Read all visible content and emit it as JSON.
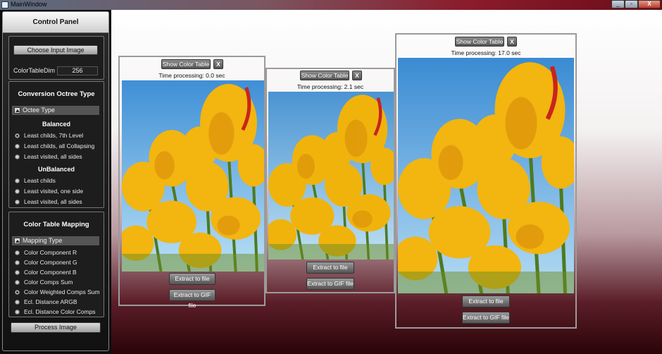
{
  "window": {
    "title": "MainWindow",
    "min": "_",
    "max": "▫",
    "close": "X"
  },
  "control_panel": {
    "title": "Control Panel",
    "choose_input_label": "Choose Input Image",
    "color_table_dim_label": "ColorTableDim",
    "color_table_dim_value": "256",
    "conversion": {
      "title": "Conversion Octree Type",
      "expander_label": "Octee Type",
      "balanced_title": "Balanced",
      "balanced_options": [
        "Least childs, 7th Level",
        "Least childs, all Collapsing",
        "Least visited, all sides"
      ],
      "unbalanced_title": "UnBalanced",
      "unbalanced_options": [
        "Least childs",
        "Least visited, one side",
        "Least visited, all sides"
      ],
      "selected": "Least childs, 7th Level"
    },
    "mapping": {
      "title": "Color Table Mapping",
      "expander_label": "Mapping Type",
      "options": [
        "Color Component R",
        "Color Component G",
        "Color Component B",
        "Color Comps Sum",
        "Color Weighted Comps Sum",
        "Ecl. Distance ARGB",
        "Ecl. Distance Color Comps"
      ],
      "selected": "Color Weighted Comps Sum"
    },
    "process_label": "Process Image"
  },
  "results": [
    {
      "show_table_label": "Show Color Table",
      "close_label": "X",
      "time_text": "Time processing: 0.0 sec",
      "extract_label": "Extract to file",
      "extract_gif_label": "Extract to GIF file"
    },
    {
      "show_table_label": "Show Color Table",
      "close_label": "X",
      "time_text": "Time processing: 2.1 sec",
      "extract_label": "Extract to file",
      "extract_gif_label": "Extract to GIF file"
    },
    {
      "show_table_label": "Show Color Table",
      "close_label": "X",
      "time_text": "Time processing: 17.0 sec",
      "extract_label": "Extract to file",
      "extract_gif_label": "Extract to GIF file"
    }
  ],
  "colors": {
    "sky": "#6fb6e6",
    "petal": "#f3b50f",
    "stem": "#4e7a1e",
    "accent_red": "#c8241e"
  }
}
